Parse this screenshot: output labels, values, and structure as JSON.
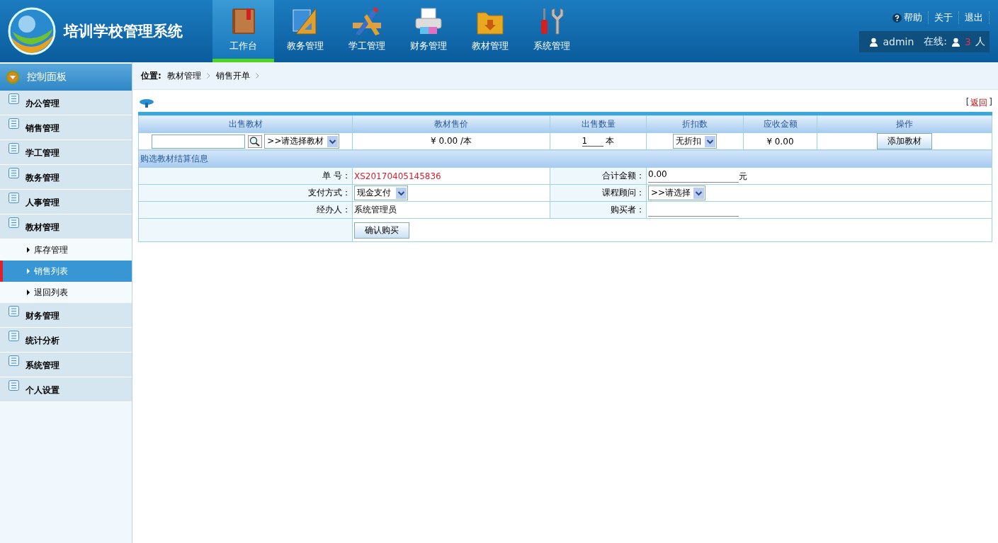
{
  "header": {
    "title": "培训学校管理系统",
    "nav": [
      {
        "label": "工作台",
        "kind": "book",
        "selected": true
      },
      {
        "label": "教务管理",
        "kind": "ruler",
        "selected": false
      },
      {
        "label": "学工管理",
        "kind": "pencil",
        "selected": false
      },
      {
        "label": "财务管理",
        "kind": "printer",
        "selected": false
      },
      {
        "label": "教材管理",
        "kind": "folder",
        "selected": false
      },
      {
        "label": "系统管理",
        "kind": "tools",
        "selected": false
      }
    ],
    "links": [
      {
        "label": "帮助",
        "kind": "help"
      },
      {
        "label": "关于",
        "kind": "plain"
      },
      {
        "label": "退出",
        "kind": "plain"
      }
    ],
    "user": {
      "name": "admin",
      "online_label": "在线:",
      "online_count": "3",
      "unit": "人"
    }
  },
  "sidebar": {
    "title": "控制面板",
    "items": [
      {
        "label": "办公管理"
      },
      {
        "label": "销售管理"
      },
      {
        "label": "学工管理"
      },
      {
        "label": "教务管理"
      },
      {
        "label": "人事管理"
      },
      {
        "label": "教材管理",
        "children": [
          {
            "label": "库存管理",
            "selected": false
          },
          {
            "label": "销售列表",
            "selected": true
          },
          {
            "label": "退回列表",
            "selected": false
          }
        ]
      },
      {
        "label": "财务管理"
      },
      {
        "label": "统计分析"
      },
      {
        "label": "系统管理"
      },
      {
        "label": "个人设置"
      }
    ]
  },
  "breadcrumb": {
    "label": "位置:",
    "items": [
      "教材管理",
      "销售开单"
    ]
  },
  "back_link": {
    "open": "[",
    "label": "返回",
    "close": "]"
  },
  "form": {
    "columns": [
      "出售教材",
      "教材售价",
      "出售数量",
      "折扣数",
      "应收金额",
      "操作"
    ],
    "item_row": {
      "book_select": ">>请选择教材",
      "price": "¥ 0.00 /本",
      "quantity": "1",
      "quantity_unit": "本",
      "discount": "无折扣",
      "amount": "¥ 0.00",
      "add_button": "添加教材"
    },
    "section_title": "购选教材结算信息",
    "order_no": {
      "label": "单 号：",
      "value": "XS20170405145836"
    },
    "total": {
      "label": "合计金额：",
      "value": "0.00",
      "unit": "元"
    },
    "payment": {
      "label": "支付方式：",
      "value": "现金支付"
    },
    "advisor": {
      "label": "课程顾问：",
      "value": ">>请选择"
    },
    "handler": {
      "label": "经办人：",
      "value": "系统管理员"
    },
    "buyer": {
      "label": "购买者："
    },
    "confirm_button": "确认购买"
  }
}
